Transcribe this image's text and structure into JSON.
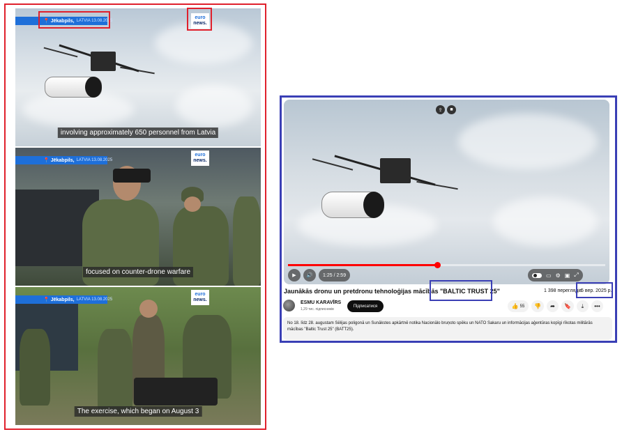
{
  "left_collage": {
    "frames": [
      {
        "location": "Jēkabpils,",
        "country_date": "LATVIA 13.08.2025",
        "logo_top": "euro",
        "logo_bottom": "news.",
        "subtitle": "involving approximately 650 personnel from Latvia"
      },
      {
        "location": "Jēkabpils,",
        "country_date": "LATVIA 13.08.2025",
        "logo_top": "euro",
        "logo_bottom": "news.",
        "subtitle": "focused on counter-drone warfare"
      },
      {
        "location": "Jēkabpils,",
        "country_date": "LATVIA 13.08.2025",
        "logo_top": "euro",
        "logo_bottom": "news.",
        "subtitle": "The exercise, which began on August 3"
      }
    ],
    "highlight_color": "#e0202c"
  },
  "video_player": {
    "time": "1:25 / 2:59",
    "progress_fraction": 0.47,
    "title": "Jaunākās dronu un pretdronu tehnoloģijas mācībās \"BALTIC TRUST 25\"",
    "views": "1 398 переглядів",
    "date": "5 вер. 2025 р.",
    "channel": {
      "name": "ESMU KARAVĪRS",
      "subscribers": "1,29 тис. підписників",
      "subscribe_label": "Підписатися"
    },
    "actions": {
      "like_count": "55",
      "more": "•••"
    },
    "description": "No 18. līdz 28. augustam Sēlijas poligonā un Sunākstes apkārtnē notika Nacionālo bruņoto spēku un NATO Sakaru un informācijas aģentūras kopīgi rīkotas militārās mācības \"Baltic Trust 25\" (BATT25).",
    "highlight_color": "#3a3fb5"
  }
}
